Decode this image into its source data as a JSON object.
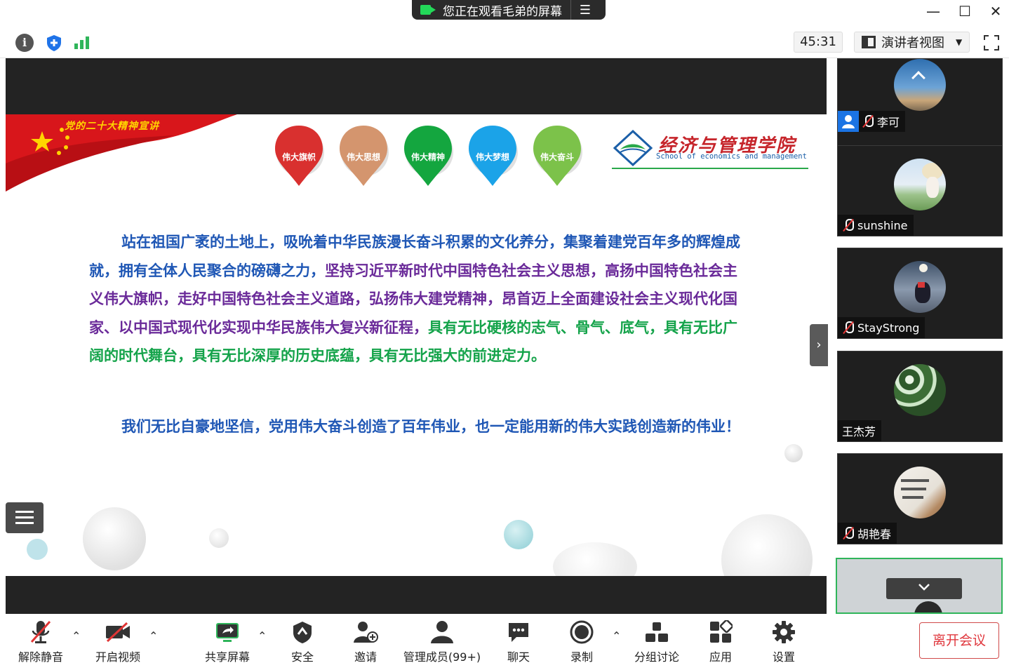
{
  "titlebar": {
    "share_notice": "您正在观看毛弟的屏幕",
    "menu_icon": "list-icon",
    "minimize": "—",
    "maximize": "☐",
    "close": "✕"
  },
  "infobar": {
    "info_icon": "i",
    "timer": "45:31",
    "view_mode": "演讲者视图"
  },
  "slide": {
    "header_title": "党的二十大精神宣讲",
    "pins": [
      {
        "label": "伟大旗帜",
        "color": "#d9302f"
      },
      {
        "label": "伟大思想",
        "color": "#d4956e"
      },
      {
        "label": "伟大精神",
        "color": "#14a63f"
      },
      {
        "label": "伟大梦想",
        "color": "#1ba3e8"
      },
      {
        "label": "伟大奋斗",
        "color": "#7cc24a"
      }
    ],
    "logo_cn": "经济与管理学院",
    "logo_en": "School of economics and management",
    "paragraph1": {
      "blue_part": "站在祖国广袤的土地上，吸吮着中华民族漫长奋斗积累的文化养分，集聚着建党百年多的辉煌成就，拥有全体人民聚合的磅礴之力，",
      "purple_part": "坚持习近平新时代中国特色社会主义思想，高扬中国特色社会主义伟大旗帜，走好中国特色社会主义道路，弘扬伟大建党精神，昂首迈上全面建设社会主义现代化国家、以中国式现代化实现中华民族伟大复兴新征程，",
      "green_part": "具有无比硬核的志气、骨气、底气，具有无比广阔的时代舞台，具有无比深厚的历史底蕴，具有无比强大的前进定力。"
    },
    "paragraph2": "我们无比自豪地坚信，党用伟大奋斗创造了百年伟业，也一定能用新的伟大实践创造新的伟业！"
  },
  "participants": [
    {
      "name": "李可",
      "host": true
    },
    {
      "name": "sunshine",
      "host": false
    },
    {
      "name": "StayStrong",
      "host": false
    },
    {
      "name": "王杰芳",
      "host": false
    },
    {
      "name": "胡艳春",
      "host": false
    }
  ],
  "toolbar": {
    "unmute": "解除静音",
    "start_video": "开启视频",
    "share_screen": "共享屏幕",
    "security": "安全",
    "invite": "邀请",
    "participants": "管理成员(99+)",
    "chat": "聊天",
    "record": "录制",
    "breakout": "分组讨论",
    "apps": "应用",
    "settings": "设置",
    "leave": "离开会议"
  },
  "colors": {
    "accent_green": "#2fb55a",
    "leave_red": "#e0383e",
    "text_blue": "#1f57b5",
    "text_purple": "#6a2a99",
    "text_green": "#14a34a"
  }
}
